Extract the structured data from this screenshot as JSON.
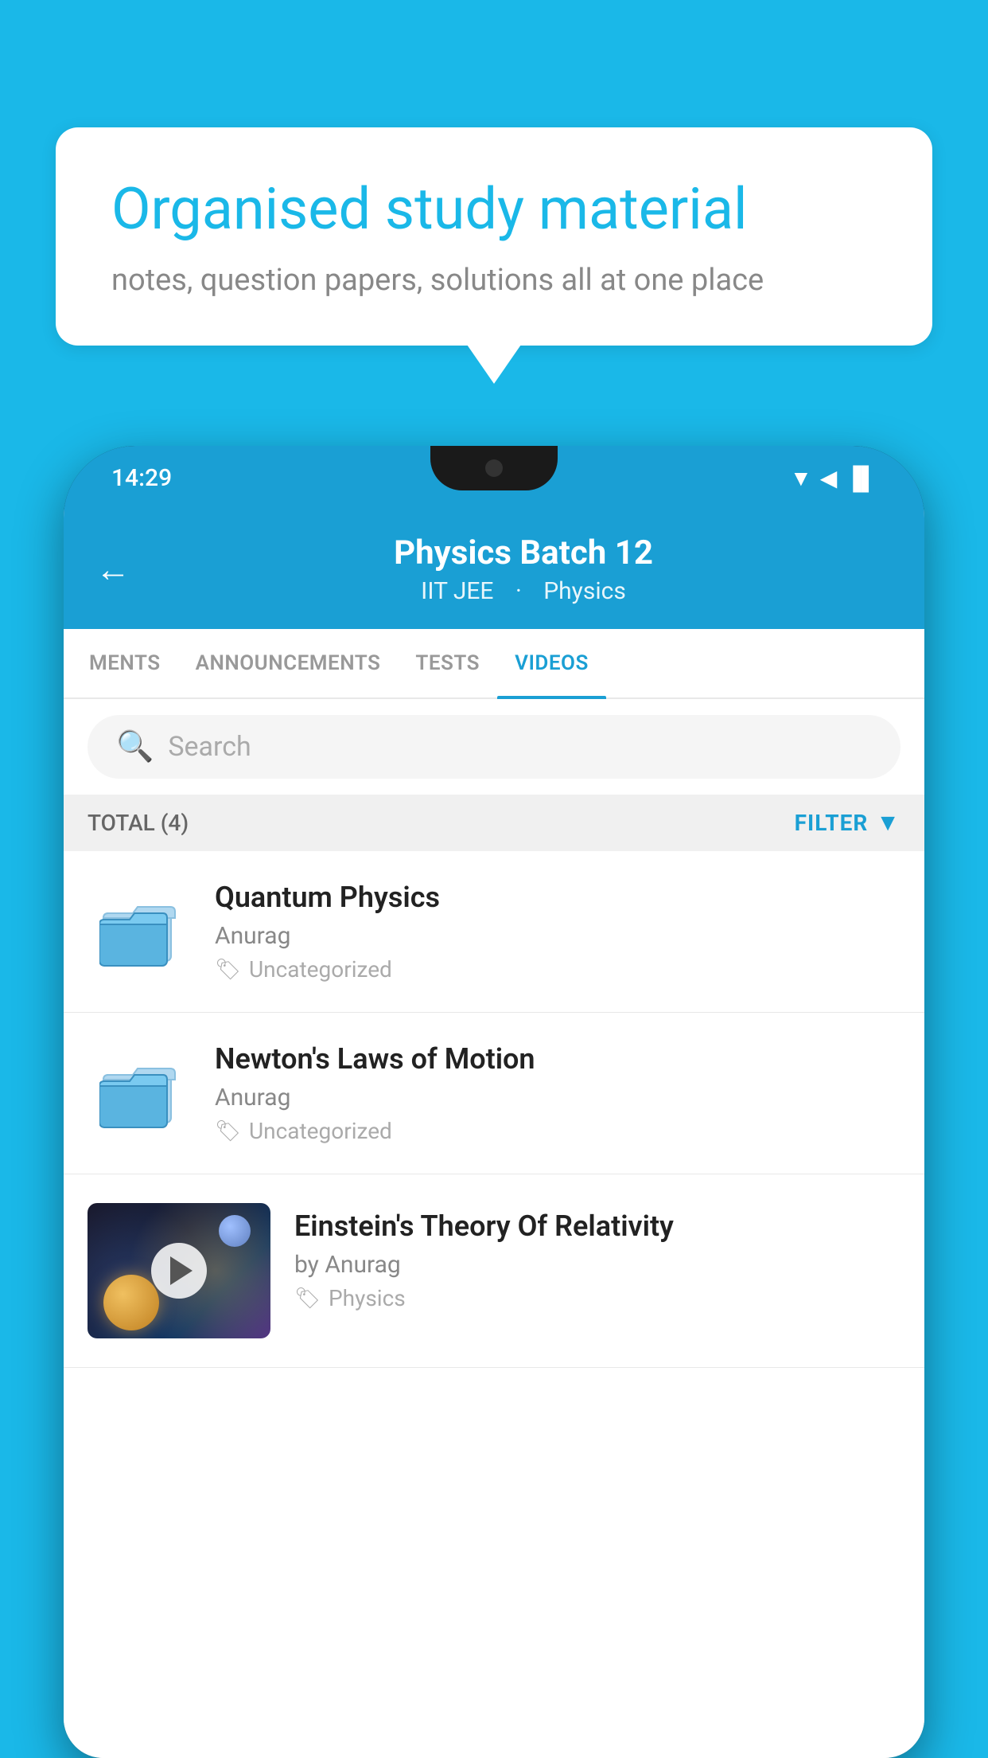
{
  "background": {
    "color": "#1ab8e8"
  },
  "bubble": {
    "title": "Organised study material",
    "subtitle": "notes, question papers, solutions all at one place"
  },
  "phone": {
    "status_bar": {
      "time": "14:29",
      "icons": "▼◀▐"
    },
    "header": {
      "back_label": "←",
      "title": "Physics Batch 12",
      "subtitle_part1": "IIT JEE",
      "subtitle_part2": "Physics"
    },
    "tabs": [
      {
        "label": "MENTS",
        "active": false
      },
      {
        "label": "ANNOUNCEMENTS",
        "active": false
      },
      {
        "label": "TESTS",
        "active": false
      },
      {
        "label": "VIDEOS",
        "active": true
      }
    ],
    "search": {
      "placeholder": "Search"
    },
    "filter_row": {
      "total_label": "TOTAL (4)",
      "filter_label": "FILTER"
    },
    "videos": [
      {
        "id": 1,
        "title": "Quantum Physics",
        "author": "Anurag",
        "tag": "Uncategorized",
        "type": "folder"
      },
      {
        "id": 2,
        "title": "Newton's Laws of Motion",
        "author": "Anurag",
        "tag": "Uncategorized",
        "type": "folder"
      },
      {
        "id": 3,
        "title": "Einstein's Theory Of Relativity",
        "author": "by Anurag",
        "tag": "Physics",
        "type": "video"
      }
    ]
  }
}
